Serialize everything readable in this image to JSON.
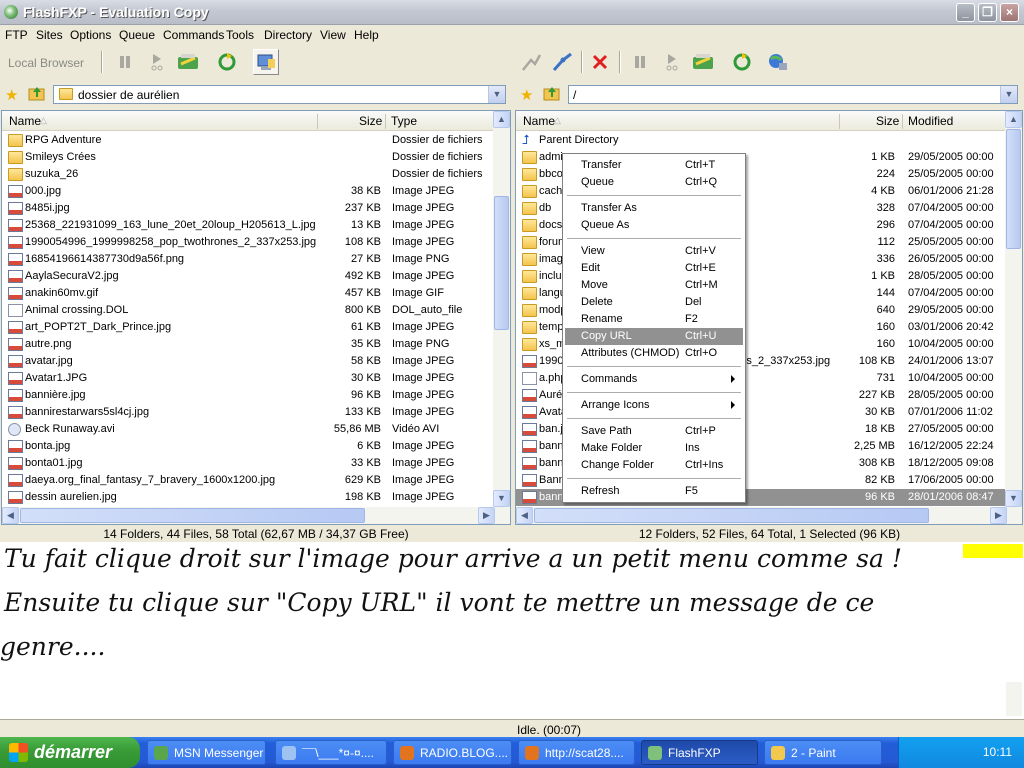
{
  "window": {
    "title": "FlashFXP - Evaluation Copy",
    "minimize": "_",
    "maximize": "❐",
    "close": "×"
  },
  "menu": [
    "FTP",
    "Sites",
    "Options",
    "Queue",
    "Commands",
    "Tools",
    "Directory",
    "View",
    "Help"
  ],
  "left": {
    "local_browser": "Local Browser",
    "path": "dossier de aurélien",
    "columns": {
      "name": "Name",
      "size": "Size",
      "type": "Type"
    },
    "files": [
      {
        "name": "RPG Adventure",
        "size": "",
        "type": "Dossier de fichiers",
        "icon": "folder-icon"
      },
      {
        "name": "Smileys Crées",
        "size": "",
        "type": "Dossier de fichiers",
        "icon": "folder-icon"
      },
      {
        "name": "suzuka_26",
        "size": "",
        "type": "Dossier de fichiers",
        "icon": "folder-icon"
      },
      {
        "name": "000.jpg",
        "size": "38 KB",
        "type": "Image JPEG",
        "icon": "image-file-icon"
      },
      {
        "name": "8485i.jpg",
        "size": "237 KB",
        "type": "Image JPEG",
        "icon": "image-file-icon"
      },
      {
        "name": "25368_221931099_163_lune_20et_20loup_H205613_L.jpg",
        "size": "13 KB",
        "type": "Image JPEG",
        "icon": "image-file-icon"
      },
      {
        "name": "1990054996_1999998258_pop_twothrones_2_337x253.jpg",
        "size": "108 KB",
        "type": "Image JPEG",
        "icon": "image-file-icon"
      },
      {
        "name": "16854196614387730d9a56f.png",
        "size": "27 KB",
        "type": "Image PNG",
        "icon": "image-file-icon"
      },
      {
        "name": "AaylaSecuraV2.jpg",
        "size": "492 KB",
        "type": "Image JPEG",
        "icon": "image-file-icon"
      },
      {
        "name": "anakin60mv.gif",
        "size": "457 KB",
        "type": "Image GIF",
        "icon": "image-file-icon"
      },
      {
        "name": "Animal crossing.DOL",
        "size": "800 KB",
        "type": "DOL_auto_file",
        "icon": "file-icon"
      },
      {
        "name": "art_POPT2T_Dark_Prince.jpg",
        "size": "61 KB",
        "type": "Image JPEG",
        "icon": "image-file-icon"
      },
      {
        "name": "autre.png",
        "size": "35 KB",
        "type": "Image PNG",
        "icon": "image-file-icon"
      },
      {
        "name": "avatar.jpg",
        "size": "58 KB",
        "type": "Image JPEG",
        "icon": "image-file-icon"
      },
      {
        "name": "Avatar1.JPG",
        "size": "30 KB",
        "type": "Image JPEG",
        "icon": "image-file-icon"
      },
      {
        "name": "bannière.jpg",
        "size": "96 KB",
        "type": "Image JPEG",
        "icon": "image-file-icon"
      },
      {
        "name": "bannirestarwars5sl4cj.jpg",
        "size": "133 KB",
        "type": "Image JPEG",
        "icon": "image-file-icon"
      },
      {
        "name": "Beck Runaway.avi",
        "size": "55,86 MB",
        "type": "Vidéo AVI",
        "icon": "video-file-icon"
      },
      {
        "name": "bonta.jpg",
        "size": "6 KB",
        "type": "Image JPEG",
        "icon": "image-file-icon"
      },
      {
        "name": "bonta01.jpg",
        "size": "33 KB",
        "type": "Image JPEG",
        "icon": "image-file-icon"
      },
      {
        "name": "daeya.org_final_fantasy_7_bravery_1600x1200.jpg",
        "size": "629 KB",
        "type": "Image JPEG",
        "icon": "image-file-icon"
      },
      {
        "name": "dessin aurelien.jpg",
        "size": "198 KB",
        "type": "Image JPEG",
        "icon": "image-file-icon"
      }
    ],
    "status": "14 Folders, 44 Files, 58 Total (62,67 MB / 34,37 GB Free)"
  },
  "right": {
    "path": "/",
    "columns": {
      "name": "Name",
      "size": "Size",
      "modified": "Modified"
    },
    "files": [
      {
        "name": "Parent Directory",
        "size": "",
        "modified": "",
        "icon": "parent-directory-icon"
      },
      {
        "name": "admin",
        "size": "1 KB",
        "modified": "29/05/2005 00:00",
        "icon": "folder-icon"
      },
      {
        "name": "bbcode",
        "size": "224",
        "modified": "25/05/2005 00:00",
        "icon": "folder-icon"
      },
      {
        "name": "cache",
        "size": "4 KB",
        "modified": "06/01/2006 21:28",
        "icon": "folder-icon"
      },
      {
        "name": "db",
        "size": "328",
        "modified": "07/04/2005 00:00",
        "icon": "folder-icon"
      },
      {
        "name": "docs",
        "size": "296",
        "modified": "07/04/2005 00:00",
        "icon": "folder-icon"
      },
      {
        "name": "forum",
        "size": "112",
        "modified": "25/05/2005 00:00",
        "icon": "folder-icon"
      },
      {
        "name": "images",
        "size": "336",
        "modified": "26/05/2005 00:00",
        "icon": "folder-icon"
      },
      {
        "name": "includes",
        "size": "1 KB",
        "modified": "28/05/2005 00:00",
        "icon": "folder-icon"
      },
      {
        "name": "language",
        "size": "144",
        "modified": "07/04/2005 00:00",
        "icon": "folder-icon"
      },
      {
        "name": "modpack",
        "size": "640",
        "modified": "29/05/2005 00:00",
        "icon": "folder-icon"
      },
      {
        "name": "templates",
        "size": "160",
        "modified": "03/01/2006 20:42",
        "icon": "folder-icon"
      },
      {
        "name": "xs_mod",
        "size": "160",
        "modified": "10/04/2005 00:00",
        "icon": "folder-icon"
      },
      {
        "name": "1990054996_1999998258_pop_twothrones_2_337x253.jpg",
        "size": "108 KB",
        "modified": "24/01/2006 13:07",
        "icon": "image-file-icon"
      },
      {
        "name": "a.php",
        "size": "731",
        "modified": "10/04/2005 00:00",
        "icon": "file-icon"
      },
      {
        "name": "Auréliens.jpg",
        "size": "227 KB",
        "modified": "28/05/2005 00:00",
        "icon": "image-file-icon"
      },
      {
        "name": "Avatar.jpg",
        "size": "30 KB",
        "modified": "07/01/2006 11:02",
        "icon": "image-file-icon"
      },
      {
        "name": "ban.jpg",
        "size": "18 KB",
        "modified": "27/05/2005 00:00",
        "icon": "image-file-icon"
      },
      {
        "name": "banniere.bmp",
        "size": "2,25 MB",
        "modified": "16/12/2005 22:24",
        "icon": "image-file-icon"
      },
      {
        "name": "banniere.png",
        "size": "308 KB",
        "modified": "18/12/2005 09:08",
        "icon": "image-file-icon"
      },
      {
        "name": "Banniere.jpg",
        "size": "82 KB",
        "modified": "17/06/2005 00:00",
        "icon": "image-file-icon"
      },
      {
        "name": "bannière.jpg",
        "size": "96 KB",
        "modified": "28/01/2006 08:47",
        "icon": "image-file-icon"
      }
    ],
    "status": "12 Folders, 52 Files, 64 Total, 1 Selected (96 KB)"
  },
  "context_menu": [
    {
      "label": "Transfer",
      "shortcut": "Ctrl+T"
    },
    {
      "label": "Queue",
      "shortcut": "Ctrl+Q"
    },
    {
      "sep": true
    },
    {
      "label": "Transfer As",
      "shortcut": ""
    },
    {
      "label": "Queue As",
      "shortcut": ""
    },
    {
      "sep": true
    },
    {
      "label": "View",
      "shortcut": "Ctrl+V"
    },
    {
      "label": "Edit",
      "shortcut": "Ctrl+E"
    },
    {
      "label": "Move",
      "shortcut": "Ctrl+M"
    },
    {
      "label": "Delete",
      "shortcut": "Del"
    },
    {
      "label": "Rename",
      "shortcut": "F2"
    },
    {
      "label": "Copy URL",
      "shortcut": "Ctrl+U",
      "highlighted": true
    },
    {
      "label": "Attributes (CHMOD)",
      "shortcut": "Ctrl+O"
    },
    {
      "sep": true
    },
    {
      "label": "Commands",
      "shortcut": "",
      "submenu": true
    },
    {
      "sep": true
    },
    {
      "label": "Arrange Icons",
      "shortcut": "",
      "submenu": true
    },
    {
      "sep": true
    },
    {
      "label": "Save Path",
      "shortcut": "Ctrl+P"
    },
    {
      "label": "Make Folder",
      "shortcut": "Ins"
    },
    {
      "label": "Change Folder",
      "shortcut": "Ctrl+Ins"
    },
    {
      "sep": true
    },
    {
      "label": "Refresh",
      "shortcut": "F5"
    }
  ],
  "annotation": {
    "lines": [
      "Tu fait clique droit sur l'image pour arrive a un petit menu comme sa !",
      "Ensuite tu clique sur \"Copy URL\" il vont te mettre un message de ce",
      "genre...."
    ]
  },
  "idle_status": "Idle. (00:07)",
  "taskbar": {
    "start": "démarrer",
    "tasks": [
      {
        "label": "MSN Messenger",
        "icon": "msn-messenger-icon",
        "active": false
      },
      {
        "label": "¯¯\\___*¤-¤....",
        "icon": "chat-window-icon",
        "active": false
      },
      {
        "label": "RADIO.BLOG....",
        "icon": "firefox-icon",
        "active": false
      },
      {
        "label": "http://scat28....",
        "icon": "firefox-icon",
        "active": false
      },
      {
        "label": "FlashFXP",
        "icon": "flashfxp-icon",
        "active": true
      },
      {
        "label": "2 - Paint",
        "icon": "paint-icon",
        "active": false
      }
    ],
    "clock": "10:11"
  },
  "colors": {
    "selection": "#919191",
    "titlebar": "#c4c8d2",
    "taskbar": "#2559d4",
    "start": "#3a9d38"
  }
}
